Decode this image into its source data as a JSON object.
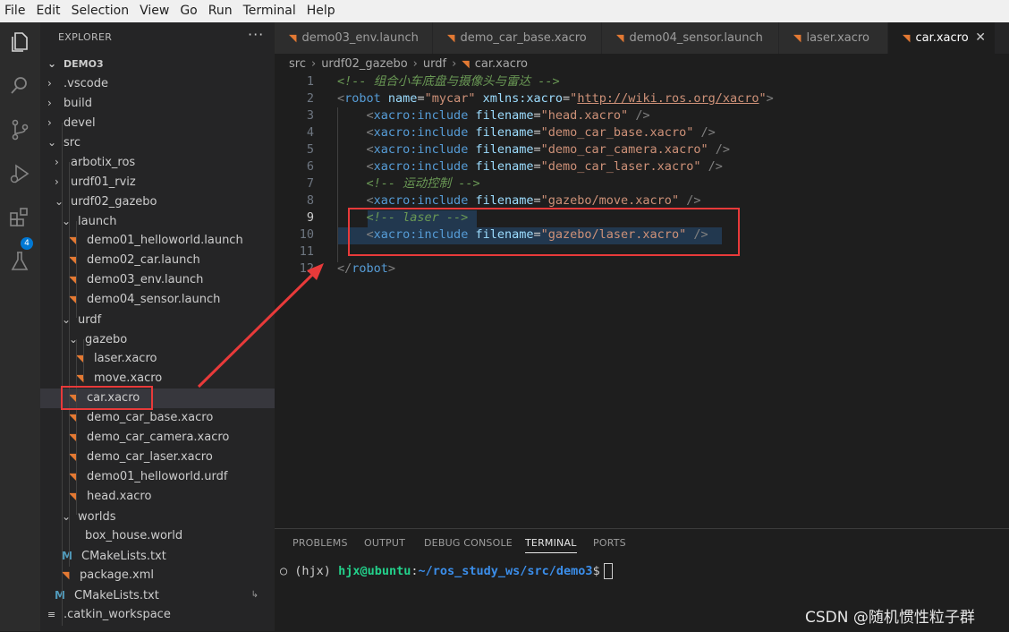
{
  "menu": [
    "File",
    "Edit",
    "Selection",
    "View",
    "Go",
    "Run",
    "Terminal",
    "Help"
  ],
  "activity_bar": {
    "icons": [
      "explorer-icon",
      "search-icon",
      "source-control-icon",
      "run-debug-icon",
      "extensions-icon",
      "testing-icon"
    ],
    "extensions_badge": "4"
  },
  "explorer": {
    "header": "EXPLORER",
    "more": "···",
    "tree": [
      {
        "label": "DEMO3",
        "depth": 0,
        "kind": "folder-open"
      },
      {
        "label": ".vscode",
        "depth": 1,
        "kind": "folder"
      },
      {
        "label": "build",
        "depth": 1,
        "kind": "folder"
      },
      {
        "label": "devel",
        "depth": 1,
        "kind": "folder"
      },
      {
        "label": "src",
        "depth": 1,
        "kind": "folder-open"
      },
      {
        "label": "arbotix_ros",
        "depth": 2,
        "kind": "folder"
      },
      {
        "label": "urdf01_rviz",
        "depth": 2,
        "kind": "folder"
      },
      {
        "label": "urdf02_gazebo",
        "depth": 2,
        "kind": "folder-open"
      },
      {
        "label": "launch",
        "depth": 3,
        "kind": "folder-open"
      },
      {
        "label": "demo01_helloworld.launch",
        "depth": 4,
        "kind": "rss"
      },
      {
        "label": "demo02_car.launch",
        "depth": 4,
        "kind": "rss"
      },
      {
        "label": "demo03_env.launch",
        "depth": 4,
        "kind": "rss"
      },
      {
        "label": "demo04_sensor.launch",
        "depth": 4,
        "kind": "rss"
      },
      {
        "label": "urdf",
        "depth": 3,
        "kind": "folder-open"
      },
      {
        "label": "gazebo",
        "depth": 4,
        "kind": "folder-open"
      },
      {
        "label": "laser.xacro",
        "depth": 5,
        "kind": "rss"
      },
      {
        "label": "move.xacro",
        "depth": 5,
        "kind": "rss"
      },
      {
        "label": "car.xacro",
        "depth": 4,
        "kind": "rss",
        "selected": true
      },
      {
        "label": "demo_car_base.xacro",
        "depth": 4,
        "kind": "rss"
      },
      {
        "label": "demo_car_camera.xacro",
        "depth": 4,
        "kind": "rss"
      },
      {
        "label": "demo_car_laser.xacro",
        "depth": 4,
        "kind": "rss"
      },
      {
        "label": "demo01_helloworld.urdf",
        "depth": 4,
        "kind": "rss"
      },
      {
        "label": "head.xacro",
        "depth": 4,
        "kind": "rss"
      },
      {
        "label": "worlds",
        "depth": 3,
        "kind": "folder-open"
      },
      {
        "label": "box_house.world",
        "depth": 4,
        "kind": "plain"
      },
      {
        "label": "CMakeLists.txt",
        "depth": 3,
        "kind": "cmake"
      },
      {
        "label": "package.xml",
        "depth": 3,
        "kind": "rss"
      },
      {
        "label": "CMakeLists.txt",
        "depth": 2,
        "kind": "cmake",
        "trailing": "↳"
      },
      {
        "label": ".catkin_workspace",
        "depth": 1,
        "kind": "text"
      }
    ]
  },
  "tabs": [
    {
      "label": "demo03_env.launch",
      "active": false
    },
    {
      "label": "demo_car_base.xacro",
      "active": false
    },
    {
      "label": "demo04_sensor.launch",
      "active": false
    },
    {
      "label": "laser.xacro",
      "active": false
    },
    {
      "label": "car.xacro",
      "active": true,
      "close": "✕"
    }
  ],
  "breadcrumb": [
    "src",
    "urdf02_gazebo",
    "urdf",
    "car.xacro"
  ],
  "code_lines": [
    {
      "n": "1",
      "parts": [
        {
          "c": "cmt",
          "t": "<!-- 组合小车底盘与摄像头与雷达 -->"
        }
      ]
    },
    {
      "n": "2",
      "parts": [
        {
          "c": "pun",
          "t": "<"
        },
        {
          "c": "tag",
          "t": "robot"
        },
        {
          "c": "",
          "t": " "
        },
        {
          "c": "attr",
          "t": "name"
        },
        {
          "c": "",
          "t": "="
        },
        {
          "c": "str",
          "t": "\"mycar\""
        },
        {
          "c": "",
          "t": " "
        },
        {
          "c": "attr",
          "t": "xmlns:xacro"
        },
        {
          "c": "",
          "t": "="
        },
        {
          "c": "str",
          "t": "\""
        },
        {
          "c": "url",
          "t": "http://wiki.ros.org/xacro"
        },
        {
          "c": "str",
          "t": "\""
        },
        {
          "c": "pun",
          "t": ">"
        }
      ]
    },
    {
      "n": "3",
      "parts": [
        {
          "c": "",
          "t": "    "
        },
        {
          "c": "pun",
          "t": "<"
        },
        {
          "c": "tag",
          "t": "xacro:include"
        },
        {
          "c": "",
          "t": " "
        },
        {
          "c": "attr",
          "t": "filename"
        },
        {
          "c": "",
          "t": "="
        },
        {
          "c": "str",
          "t": "\"head.xacro\""
        },
        {
          "c": "",
          "t": " "
        },
        {
          "c": "pun",
          "t": "/>"
        }
      ]
    },
    {
      "n": "4",
      "parts": [
        {
          "c": "",
          "t": "    "
        },
        {
          "c": "pun",
          "t": "<"
        },
        {
          "c": "tag",
          "t": "xacro:include"
        },
        {
          "c": "",
          "t": " "
        },
        {
          "c": "attr",
          "t": "filename"
        },
        {
          "c": "",
          "t": "="
        },
        {
          "c": "str",
          "t": "\"demo_car_base.xacro\""
        },
        {
          "c": "",
          "t": " "
        },
        {
          "c": "pun",
          "t": "/>"
        }
      ]
    },
    {
      "n": "5",
      "parts": [
        {
          "c": "",
          "t": "    "
        },
        {
          "c": "pun",
          "t": "<"
        },
        {
          "c": "tag",
          "t": "xacro:include"
        },
        {
          "c": "",
          "t": " "
        },
        {
          "c": "attr",
          "t": "filename"
        },
        {
          "c": "",
          "t": "="
        },
        {
          "c": "str",
          "t": "\"demo_car_camera.xacro\""
        },
        {
          "c": "",
          "t": " "
        },
        {
          "c": "pun",
          "t": "/>"
        }
      ]
    },
    {
      "n": "6",
      "parts": [
        {
          "c": "",
          "t": "    "
        },
        {
          "c": "pun",
          "t": "<"
        },
        {
          "c": "tag",
          "t": "xacro:include"
        },
        {
          "c": "",
          "t": " "
        },
        {
          "c": "attr",
          "t": "filename"
        },
        {
          "c": "",
          "t": "="
        },
        {
          "c": "str",
          "t": "\"demo_car_laser.xacro\""
        },
        {
          "c": "",
          "t": " "
        },
        {
          "c": "pun",
          "t": "/>"
        }
      ]
    },
    {
      "n": "7",
      "parts": [
        {
          "c": "",
          "t": "    "
        },
        {
          "c": "cmt",
          "t": "<!-- 运动控制 -->"
        }
      ]
    },
    {
      "n": "8",
      "parts": [
        {
          "c": "",
          "t": "    "
        },
        {
          "c": "pun",
          "t": "<"
        },
        {
          "c": "tag",
          "t": "xacro:include"
        },
        {
          "c": "",
          "t": " "
        },
        {
          "c": "attr",
          "t": "filename"
        },
        {
          "c": "",
          "t": "="
        },
        {
          "c": "str",
          "t": "\"gazebo/move.xacro\""
        },
        {
          "c": "",
          "t": " "
        },
        {
          "c": "pun",
          "t": "/>"
        }
      ]
    },
    {
      "n": "9",
      "parts": [
        {
          "c": "",
          "t": "    "
        },
        {
          "c": "cmt",
          "t": "<!-- laser -->"
        }
      ],
      "current": true
    },
    {
      "n": "10",
      "parts": [
        {
          "c": "",
          "t": "    "
        },
        {
          "c": "pun",
          "t": "<"
        },
        {
          "c": "tag",
          "t": "xacro:include"
        },
        {
          "c": "",
          "t": " "
        },
        {
          "c": "attr",
          "t": "filename"
        },
        {
          "c": "",
          "t": "="
        },
        {
          "c": "str",
          "t": "\"gazebo/laser.xacro\""
        },
        {
          "c": "",
          "t": " "
        },
        {
          "c": "pun",
          "t": "/>"
        }
      ]
    },
    {
      "n": "11",
      "parts": []
    },
    {
      "n": "12",
      "parts": [
        {
          "c": "pun",
          "t": "</"
        },
        {
          "c": "tag",
          "t": "robot"
        },
        {
          "c": "pun",
          "t": ">"
        }
      ]
    }
  ],
  "panel": {
    "tabs": [
      "PROBLEMS",
      "OUTPUT",
      "DEBUG CONSOLE",
      "TERMINAL",
      "PORTS"
    ],
    "active": "TERMINAL",
    "terminal": {
      "bullet": "○",
      "env": "(hjx)",
      "user": "hjx@ubuntu",
      "colon": ":",
      "path": "~/ros_study_ws/src/demo3",
      "prompt": "$"
    }
  },
  "watermark": "CSDN @随机惯性粒子群",
  "colors": {
    "accent": "#0078d4",
    "annotation": "#e83a3a",
    "xacro_icon": "#e37933"
  }
}
